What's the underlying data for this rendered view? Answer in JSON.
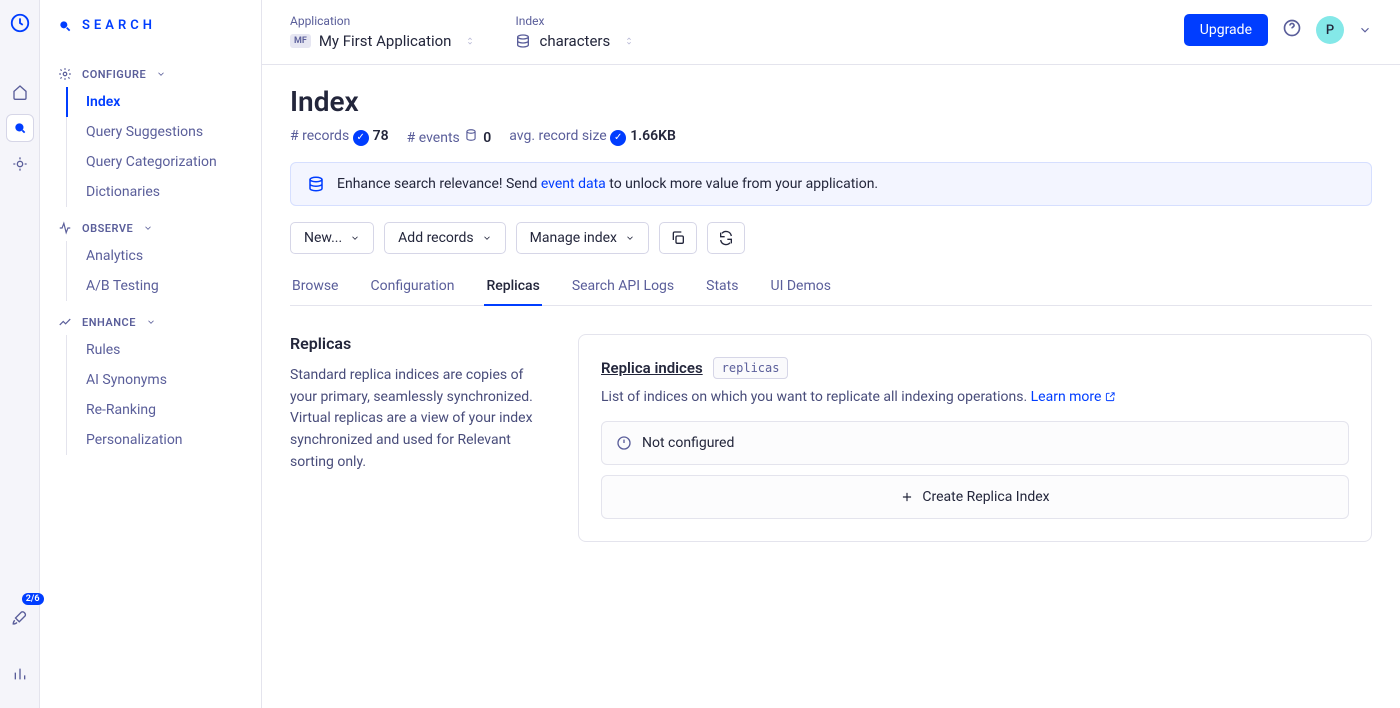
{
  "brand": "SEARCH",
  "rail": {
    "badge": "2/6"
  },
  "sidebar": {
    "sections": [
      {
        "label": "CONFIGURE",
        "items": [
          "Index",
          "Query Suggestions",
          "Query Categorization",
          "Dictionaries"
        ],
        "active": 0
      },
      {
        "label": "OBSERVE",
        "items": [
          "Analytics",
          "A/B Testing"
        ]
      },
      {
        "label": "ENHANCE",
        "items": [
          "Rules",
          "AI Synonyms",
          "Re-Ranking",
          "Personalization"
        ]
      }
    ]
  },
  "header": {
    "app_label": "Application",
    "app_badge": "MF",
    "app_value": "My First Application",
    "index_label": "Index",
    "index_value": "characters",
    "upgrade": "Upgrade",
    "avatar": "P"
  },
  "page": {
    "title": "Index",
    "stats": {
      "records_label": "# records",
      "records": "78",
      "events_label": "# events",
      "events": "0",
      "size_label": "avg. record size",
      "size": "1.66KB"
    },
    "banner": {
      "prefix": "Enhance search relevance! Send ",
      "link": "event data",
      "suffix": " to unlock more value from your application."
    },
    "actions": {
      "new": "New...",
      "add": "Add records",
      "manage": "Manage index"
    },
    "tabs": [
      "Browse",
      "Configuration",
      "Replicas",
      "Search API Logs",
      "Stats",
      "UI Demos"
    ],
    "active_tab": 2
  },
  "replicas": {
    "heading": "Replicas",
    "p1": "Standard replica indices are copies of your primary, seamlessly synchronized.",
    "p2": "Virtual replicas are a view of your index synchronized and used for Relevant sorting only.",
    "panel": {
      "title": "Replica indices",
      "tag": "replicas",
      "desc": "List of indices on which you want to replicate all indexing operations. ",
      "learn": "Learn more",
      "empty": "Not configured",
      "create": "Create Replica Index"
    }
  }
}
